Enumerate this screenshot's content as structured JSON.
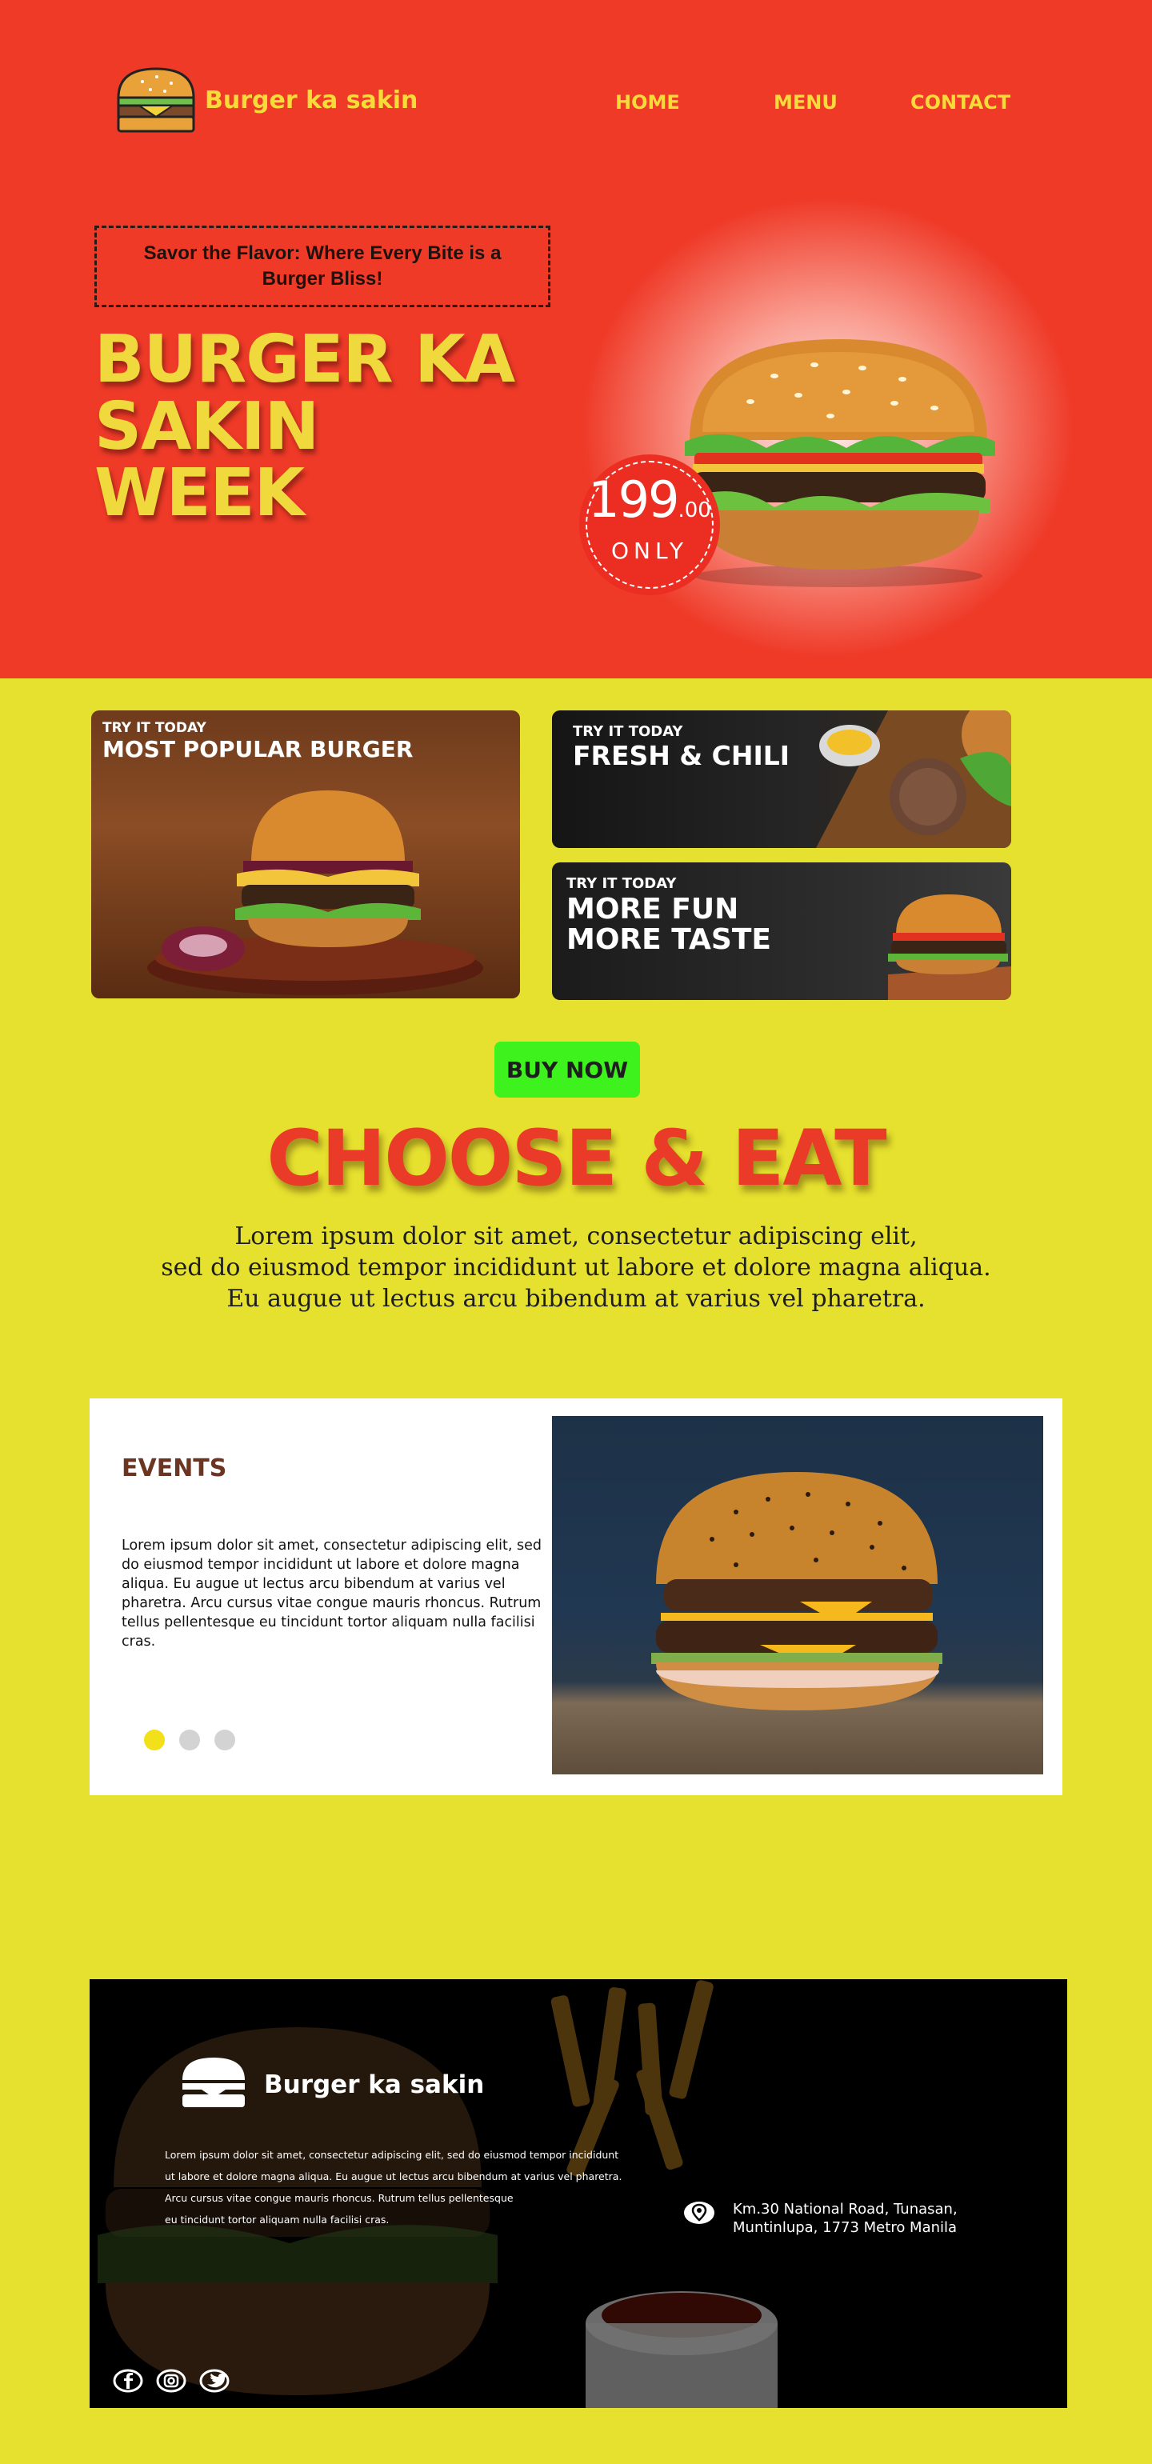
{
  "brand": {
    "name": "Burger ka sakin",
    "logo_icon": "burger-icon"
  },
  "nav": {
    "items": [
      "HOME",
      "MENU",
      "CONTACT"
    ]
  },
  "hero": {
    "tagline": "Savor the Flavor: Where Every Bite is a Burger Bliss!",
    "title_line1": "BURGER KA SAKIN",
    "title_line2": "WEEK",
    "price_main": "199",
    "price_cents": ".00",
    "price_label": "ONLY"
  },
  "promos": [
    {
      "kicker": "TRY IT TODAY",
      "title": "MOST POPULAR BURGER"
    },
    {
      "kicker": "TRY IT TODAY",
      "title": "FRESH & CHILI"
    },
    {
      "kicker": "TRY IT TODAY",
      "title_line1": "MORE FUN",
      "title_line2": "MORE TASTE"
    }
  ],
  "cta": {
    "buy_label": "BUY NOW"
  },
  "choose": {
    "title": "CHOOSE & EAT",
    "lines": [
      "Lorem ipsum dolor sit amet, consectetur adipiscing elit,",
      "sed do eiusmod tempor incididunt ut labore et dolore magna aliqua.",
      "Eu augue ut lectus arcu bibendum at varius vel pharetra."
    ]
  },
  "events": {
    "title": "EVENTS",
    "body": "Lorem ipsum dolor sit amet, consectetur adipiscing elit, sed do eiusmod tempor incididunt ut labore et dolore magna aliqua. Eu augue ut lectus arcu bibendum at varius vel pharetra. Arcu cursus vitae congue mauris rhoncus. Rutrum tellus pellentesque eu tincidunt tortor aliquam nulla facilisi cras.",
    "slide_count": 3,
    "active_slide": 1
  },
  "footer": {
    "brand": "Burger ka sakin",
    "desc_lines": [
      "Lorem ipsum dolor sit amet, consectetur adipiscing elit, sed do eiusmod tempor incididunt",
      "ut labore et dolore magna aliqua. Eu augue ut lectus arcu bibendum at varius vel pharetra.",
      "Arcu cursus vitae congue mauris rhoncus. Rutrum tellus pellentesque",
      "eu tincidunt tortor aliquam nulla facilisi cras."
    ],
    "address": "Km.30 National  Road, Tunasan, Muntinlupa, 1773 Metro Manila",
    "address_icon": "location-pin-icon",
    "socials": [
      "facebook-icon",
      "instagram-icon",
      "twitter-icon"
    ]
  },
  "colors": {
    "hero_red": "#ef3a28",
    "page_yellow": "#e6e02e",
    "title_yellow": "#f0d93c",
    "buy_green": "#3ef21e",
    "events_brown": "#6b3521"
  }
}
